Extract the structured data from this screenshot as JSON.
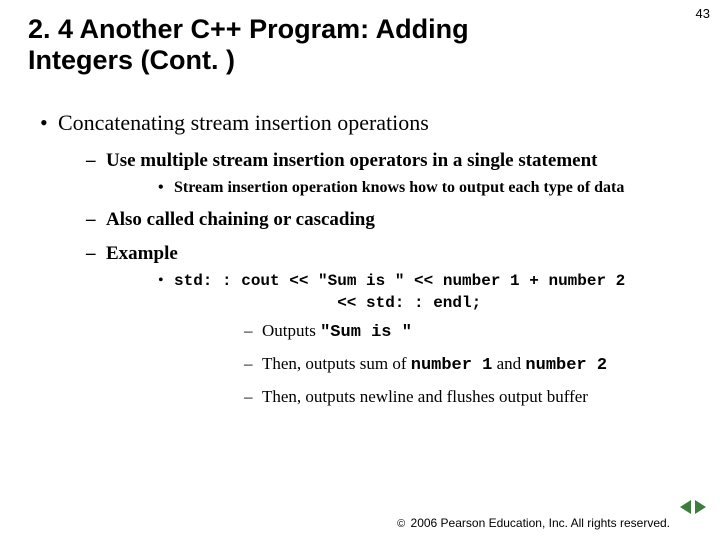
{
  "page_number": "43",
  "title": "2. 4 Another C++ Program: Adding Integers (Cont. )",
  "bullets": {
    "l1": "Concatenating stream insertion operations",
    "l2a": "Use multiple stream insertion operators in a single statement",
    "l3a": "Stream insertion operation knows how to output each type of data",
    "l2b": "Also called chaining or cascading",
    "l2c": "Example",
    "code1": "std: : cout << \"Sum is \" << number 1 + number 2",
    "code2": "<< std: : endl;",
    "l4a_pre": "Outputs ",
    "l4a_mono": "\"Sum is \"",
    "l4b_pre": "Then, outputs sum of ",
    "l4b_m1": "number 1",
    "l4b_mid": " and ",
    "l4b_m2": "number 2",
    "l4c": "Then, outputs newline and flushes output buffer"
  },
  "footer": "2006 Pearson Education, Inc.  All rights reserved.",
  "nav": {
    "prev": "previous-slide",
    "next": "next-slide"
  }
}
